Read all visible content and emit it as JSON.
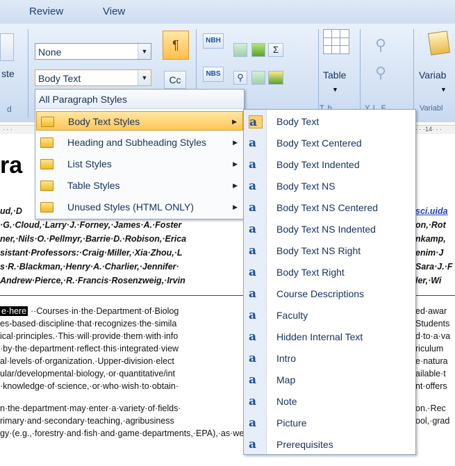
{
  "ribbon": {
    "tabs": [
      "Review",
      "View"
    ],
    "style_combo_1": "None",
    "style_combo_2": "Body Text",
    "paste_partial": "ste",
    "group_partial": "d",
    "pilcrow": "¶",
    "case_button": "Cc",
    "nbh": "NBH",
    "nbs": "NBS",
    "sigma": "Σ",
    "table_label": "Table",
    "table_group_partial": "T..b..",
    "find_group_partial": "Y..l.. F",
    "variables_label": "Variab",
    "variables_group_partial": "Variabl"
  },
  "ruler": {
    "left": "· · ·",
    "right": "· · ·14· · ·"
  },
  "document": {
    "heading_partial": "ra",
    "people_lines": [
      "ud,·D",
      "·G.·Cloud,·Larry·J.·Forney,·James·A.·Foster",
      "ner,·Nils·O.·Pellmyr,·Barrie·D.·Robison,·Erica",
      "sistant·Professors:·Craig·Miller,·Xia·Zhou,·L",
      "s·R.·Blackman,·Henry·A.·Charlier,·Jennifer·",
      "Andrew·Pierce,·R.·Francis·Rosenzweig,·Irvin"
    ],
    "people_right": [
      "sci.uida",
      "on,·Rot",
      "nkamp,",
      "enim·J",
      "Sara·J.·F",
      "ler,·Wi"
    ],
    "highlight": "e·here",
    "para_lines": [
      "··Courses·in·the·Department·of·Biolog",
      "es-based·discipline·that·recognizes·the·simila",
      "ical·principles.·This·will·provide·them·with·info",
      "·by·the·department·reflect·this·integrated·view",
      "al·levels·of·organization.·Upper-division·elect",
      "ular/developmental·biology,·or·quantitative/int",
      "·knowledge·of·science,·or·who·wish·to·obtain·"
    ],
    "para_right": [
      "ed·awar",
      "Students",
      "d·to·a·va",
      "riculum",
      "e·natura",
      "ailable·t",
      "nt·offers"
    ],
    "para2_lines": [
      "n·the·department·may·enter·a·variety·of·fields·",
      "rimary·and·secondary·teaching,·agribusiness",
      "gy·(e.g.,·forestry·and·fish·and·game·departments,·EPA),·as·well·as·a·variety·of·environ"
    ],
    "para2_right": [
      "on.·Rec",
      "ool,·grad"
    ]
  },
  "menu1": {
    "header": "All Paragraph Styles",
    "items": [
      {
        "label": "Body Text Styles"
      },
      {
        "label": "Heading and Subheading Styles"
      },
      {
        "label": "List Styles"
      },
      {
        "label": "Table Styles"
      },
      {
        "label": "Unused Styles (HTML ONLY)"
      }
    ]
  },
  "menu2": {
    "icon_glyph": "a⃒",
    "items": [
      {
        "label": "Body Text"
      },
      {
        "label": "Body Text Centered"
      },
      {
        "label": "Body Text Indented"
      },
      {
        "label": "Body Text NS"
      },
      {
        "label": "Body Text NS Centered"
      },
      {
        "label": "Body Text NS Indented"
      },
      {
        "label": "Body Text NS Right"
      },
      {
        "label": "Body Text Right"
      },
      {
        "label": "Course Descriptions"
      },
      {
        "label": "Faculty"
      },
      {
        "label": "Hidden Internal Text"
      },
      {
        "label": "Intro"
      },
      {
        "label": "Map"
      },
      {
        "label": "Note"
      },
      {
        "label": "Picture"
      },
      {
        "label": "Prerequisites"
      }
    ]
  }
}
